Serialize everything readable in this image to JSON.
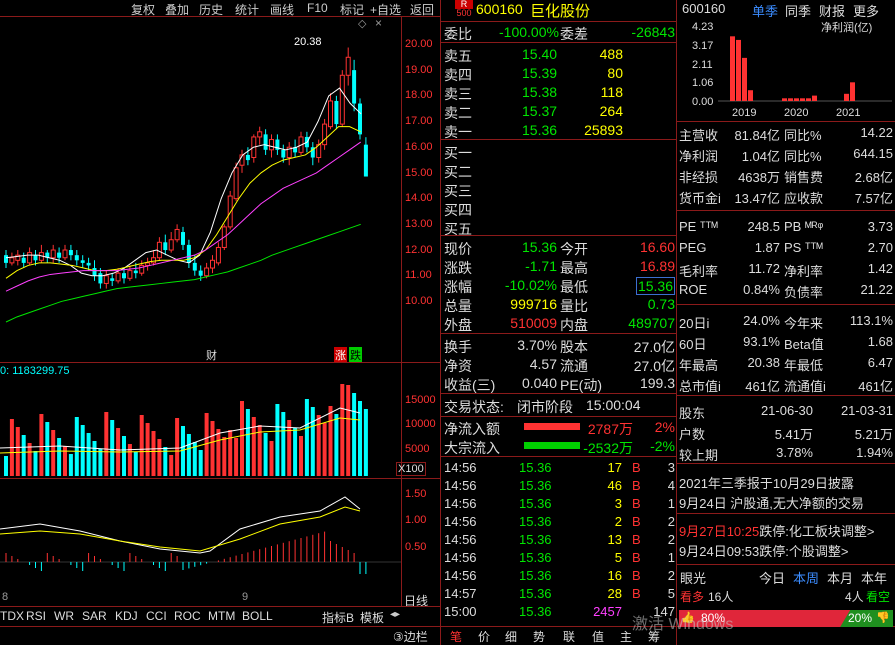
{
  "toolbar": {
    "items": [
      "复权",
      "叠加",
      "历史",
      "统计",
      "画线",
      "F10",
      "标记",
      "+自选",
      "返回"
    ]
  },
  "chart": {
    "high_label": "20.38",
    "price_ticks": [
      "20.00",
      "19.00",
      "18.00",
      "17.00",
      "16.00",
      "15.00",
      "14.00",
      "13.00",
      "12.00",
      "11.00",
      "10.00"
    ],
    "month_labels": [
      "8",
      "9"
    ],
    "markers": {
      "cai": "财",
      "zhang": "涨",
      "die": "跌"
    },
    "vol_label": "0: 1183299.75",
    "vol_ticks": [
      "15000",
      "10000",
      "5000"
    ],
    "vol_unit": "X100",
    "macd_ticks": [
      "1.50",
      "1.00",
      "0.50"
    ],
    "bottom_label": "日线"
  },
  "tabs": [
    "TDX",
    "RSI",
    "WR",
    "SAR",
    "KDJ",
    "CCI",
    "ROC",
    "MTM",
    "BOLL"
  ],
  "tabs_right": [
    "指标B",
    "模板"
  ],
  "bottom_tabs": [
    "③边栏",
    "笔",
    "价",
    "细",
    "势",
    "联",
    "值",
    "主",
    "筹"
  ],
  "stock": {
    "r_label": "R",
    "code_small": "500",
    "code": "600160",
    "name": "巨化股份"
  },
  "ratio": {
    "label": "委比",
    "value": "-100.00%",
    "label2": "委差",
    "value2": "-26843"
  },
  "asks": [
    {
      "label": "卖五",
      "price": "15.40",
      "vol": "488"
    },
    {
      "label": "卖四",
      "price": "15.39",
      "vol": "80"
    },
    {
      "label": "卖三",
      "price": "15.38",
      "vol": "118"
    },
    {
      "label": "卖二",
      "price": "15.37",
      "vol": "264"
    },
    {
      "label": "卖一",
      "price": "15.36",
      "vol": "25893"
    }
  ],
  "bids": [
    "买一",
    "买二",
    "买三",
    "买四",
    "买五"
  ],
  "quote": [
    {
      "l1": "现价",
      "v1": "15.36",
      "l2": "今开",
      "v2": "16.60"
    },
    {
      "l1": "涨跌",
      "v1": "-1.71",
      "l2": "最高",
      "v2": "16.89"
    },
    {
      "l1": "涨幅",
      "v1": "-10.02%",
      "l2": "最低",
      "v2": "15.36"
    },
    {
      "l1": "总量",
      "v1": "999716",
      "l2": "量比",
      "v2": "0.73"
    },
    {
      "l1": "外盘",
      "v1": "510009",
      "l2": "内盘",
      "v2": "489707"
    }
  ],
  "fund": [
    {
      "l1": "换手",
      "v1": "3.70%",
      "l2": "股本",
      "v2": "27.0亿"
    },
    {
      "l1": "净资",
      "v1": "4.57",
      "l2": "流通",
      "v2": "27.0亿"
    },
    {
      "l1": "收益(三)",
      "v1": "0.040",
      "l2": "PE(动)",
      "v2": "199.3"
    }
  ],
  "status": {
    "label": "交易状态:",
    "value": "闭市阶段",
    "time": "15:00:04"
  },
  "flows": [
    {
      "label": "净流入额",
      "value": "2787万",
      "pct": "2%"
    },
    {
      "label": "大宗流入",
      "value": "-2532万",
      "pct": "-2%"
    }
  ],
  "trades": [
    {
      "t": "14:56",
      "p": "15.36",
      "v": "17",
      "s": "B",
      "n": "3"
    },
    {
      "t": "14:56",
      "p": "15.36",
      "v": "46",
      "s": "B",
      "n": "4"
    },
    {
      "t": "14:56",
      "p": "15.36",
      "v": "3",
      "s": "B",
      "n": "1"
    },
    {
      "t": "14:56",
      "p": "15.36",
      "v": "2",
      "s": "B",
      "n": "2"
    },
    {
      "t": "14:56",
      "p": "15.36",
      "v": "13",
      "s": "B",
      "n": "2"
    },
    {
      "t": "14:56",
      "p": "15.36",
      "v": "5",
      "s": "B",
      "n": "1"
    },
    {
      "t": "14:56",
      "p": "15.36",
      "v": "16",
      "s": "B",
      "n": "2"
    },
    {
      "t": "14:57",
      "p": "15.36",
      "v": "28",
      "s": "B",
      "n": "5"
    },
    {
      "t": "15:00",
      "p": "15.36",
      "v": "2457",
      "s": "",
      "n": "147"
    }
  ],
  "right": {
    "code": "600160",
    "tabs": [
      "单季",
      "同季",
      "财报",
      "更多"
    ],
    "mini_chart": {
      "ylabel": "净利润(亿)",
      "yticks": [
        "4.23",
        "3.17",
        "2.11",
        "1.06",
        "0.00"
      ],
      "years": [
        "2019",
        "2020",
        "2021"
      ]
    },
    "fin": [
      {
        "l1": "主营收",
        "v1": "81.84亿",
        "l2": "同比%",
        "v2": "14.22"
      },
      {
        "l1": "净利润",
        "v1": "1.04亿",
        "l2": "同比%",
        "v2": "644.15"
      },
      {
        "l1": "非经损",
        "v1": "4638万",
        "l2": "销售费",
        "v2": "2.68亿"
      },
      {
        "l1": "货币金i",
        "v1": "13.47亿",
        "l2": "应收款",
        "v2": "7.57亿"
      }
    ],
    "val": [
      {
        "l1": "PE ᵀᵀᴹ",
        "v1": "248.5",
        "l2": "PB ᴹᴿᵠ",
        "v2": "3.73"
      },
      {
        "l1": "PEG",
        "v1": "1.87",
        "l2": "PS ᵀᵀᴹ",
        "v2": "2.70"
      },
      {
        "l1": "毛利率",
        "v1": "11.72",
        "l2": "净利率",
        "v2": "1.42"
      },
      {
        "l1": "ROE",
        "v1": "0.84%",
        "l2": "负债率",
        "v2": "21.22"
      }
    ],
    "perf": [
      {
        "l1": "20日i",
        "v1": "24.0%",
        "l2": "今年来",
        "v2": "113.1%"
      },
      {
        "l1": "60日",
        "v1": "93.1%",
        "l2": "Beta值",
        "v2": "1.68"
      },
      {
        "l1": "年最高",
        "v1": "20.38",
        "l2": "年最低",
        "v2": "6.47"
      },
      {
        "l1": "总市值i",
        "v1": "461亿",
        "l2": "流通值i",
        "v2": "461亿"
      }
    ],
    "holders": [
      {
        "l1": "股东",
        "v1": "21-06-30",
        "v2": "21-03-31"
      },
      {
        "l1": "户数",
        "v1": "5.41万",
        "v2": "5.21万"
      },
      {
        "l1": "较上期",
        "v1": "3.78%",
        "v2": "1.94%"
      }
    ],
    "news": [
      "2021年三季报于10月29日披露",
      "9月24日 沪股通,无大净额的交易"
    ],
    "alerts": [
      {
        "time": "9月27日10:25",
        "text": "跌停:化工板块调整>"
      },
      {
        "time": "9月24日09:53",
        "text": "跌停:个股调整>"
      }
    ],
    "sentiment": {
      "label": "眼光",
      "tabs": [
        "今日",
        "本周",
        "本月",
        "本年"
      ],
      "bull_label": "看多",
      "bull_count": "16人",
      "bear_count": "4人",
      "bear_label": "看空",
      "bull_pct": "80%",
      "bear_pct": "20%"
    },
    "watermark": "激活 Windows"
  },
  "colors": {
    "up": "#ff3232",
    "down": "#00e600",
    "cyan": "#00ffff",
    "yellow": "#ffff00",
    "border": "#8b1a1a"
  }
}
